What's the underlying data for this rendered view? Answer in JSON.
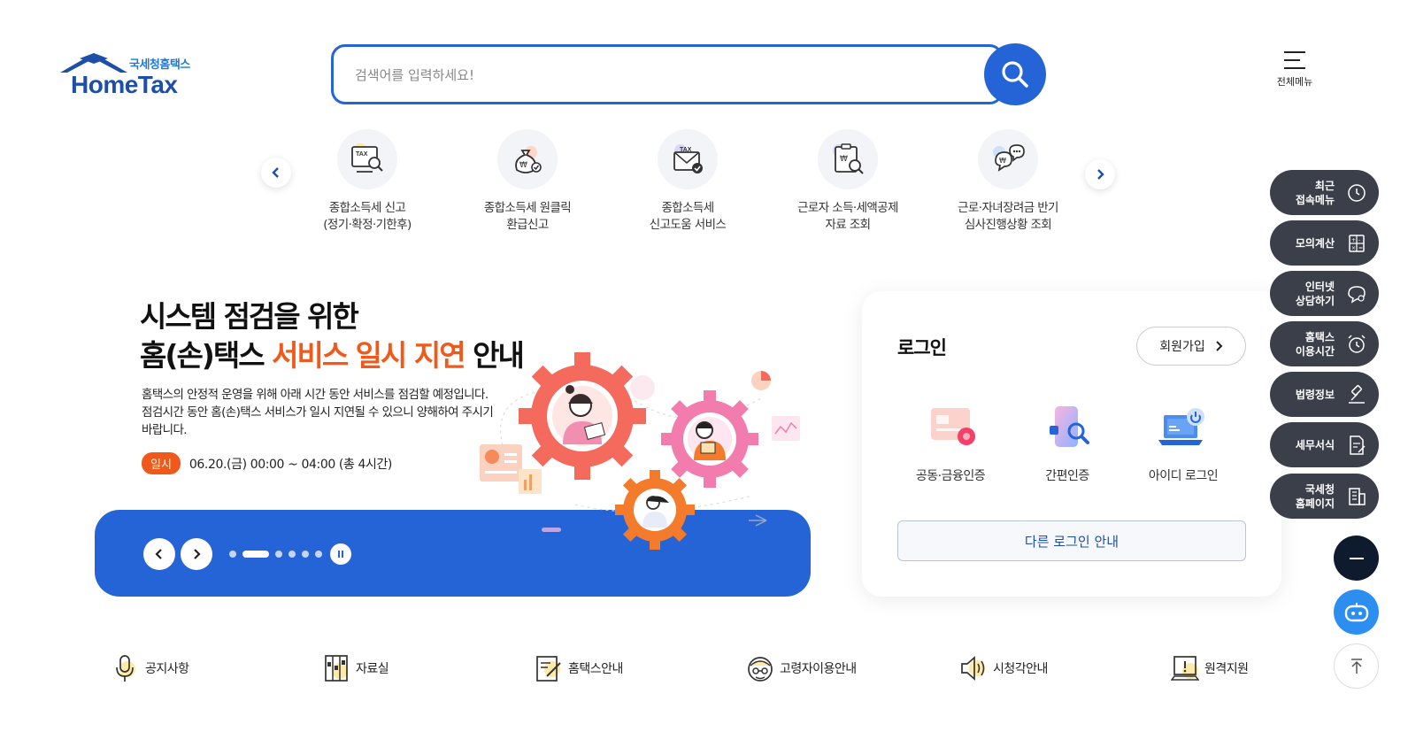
{
  "header": {
    "logo_kr": "국세청홈택스",
    "logo_en": "HomeTax",
    "search_placeholder": "검색어를 입력하세요!",
    "menu_label": "전체메뉴"
  },
  "quick_services": [
    {
      "line1": "종합소득세 신고",
      "line2": "(정기·확정·기한후)",
      "icon": "tax-monitor-icon"
    },
    {
      "line1": "종합소득세 원클릭",
      "line2": "환급신고",
      "icon": "money-bag-icon"
    },
    {
      "line1": "종합소득세",
      "line2": "신고도움 서비스",
      "icon": "tax-envelope-icon"
    },
    {
      "line1": "근로자 소득·세액공제",
      "line2": "자료 조회",
      "icon": "clipboard-search-icon"
    },
    {
      "line1": "근로·자녀장려금 반기",
      "line2": "심사진행상황 조회",
      "icon": "heart-chat-icon"
    }
  ],
  "banner": {
    "title_line1": "시스템 점검을 위한",
    "title_line2_pre": "홈(손)택스 ",
    "title_line2_hl": "서비스 일시 지연",
    "title_line2_post": " 안내",
    "desc": "홈택스의 안정적 운영을 위해 아래 시간 동안 서비스를 점검할 예정입니다. 점검시간 동안 홈(손)택스 서비스가 일시 지연될 수 있으니 양해하여 주시기 바랍니다.",
    "date_tag": "일시",
    "date_value": "06.20.(금) 00:00 ~ 04:00 (총 4시간)",
    "slide_count": 6,
    "active_slide": 1
  },
  "login": {
    "title": "로그인",
    "join_label": "회원가입",
    "options": [
      {
        "label": "공동·금융인증",
        "icon": "certificate-card-icon"
      },
      {
        "label": "간편인증",
        "icon": "phone-search-icon"
      },
      {
        "label": "아이디 로그인",
        "icon": "laptop-power-icon"
      }
    ],
    "other_label": "다른 로그인 안내"
  },
  "side_menu": [
    {
      "l1": "최근",
      "l2": "접속메뉴",
      "icon": "clock-icon"
    },
    {
      "l1": "모의계산",
      "l2": "",
      "icon": "calculator-icon"
    },
    {
      "l1": "인터넷",
      "l2": "상담하기",
      "icon": "chat-bubble-icon"
    },
    {
      "l1": "홈택스",
      "l2": "이용시간",
      "icon": "alarm-clock-icon"
    },
    {
      "l1": "법령정보",
      "l2": "",
      "icon": "gavel-icon"
    },
    {
      "l1": "세무서식",
      "l2": "",
      "icon": "document-edit-icon"
    },
    {
      "l1": "국세청",
      "l2": "홈페이지",
      "icon": "building-icon"
    }
  ],
  "bottom_links": [
    {
      "label": "공지사항",
      "icon": "microphone-icon"
    },
    {
      "label": "자료실",
      "icon": "archive-icon"
    },
    {
      "label": "홈택스안내",
      "icon": "document-pen-icon"
    },
    {
      "label": "고령자이용안내",
      "icon": "senior-icon"
    },
    {
      "label": "시청각안내",
      "icon": "speaker-icon"
    },
    {
      "label": "원격지원",
      "icon": "remote-support-icon"
    }
  ],
  "colors": {
    "primary": "#2564d6",
    "accent": "#ef5a1c",
    "side_bg": "#3a3f4a",
    "navy": "#1d4fa8"
  }
}
